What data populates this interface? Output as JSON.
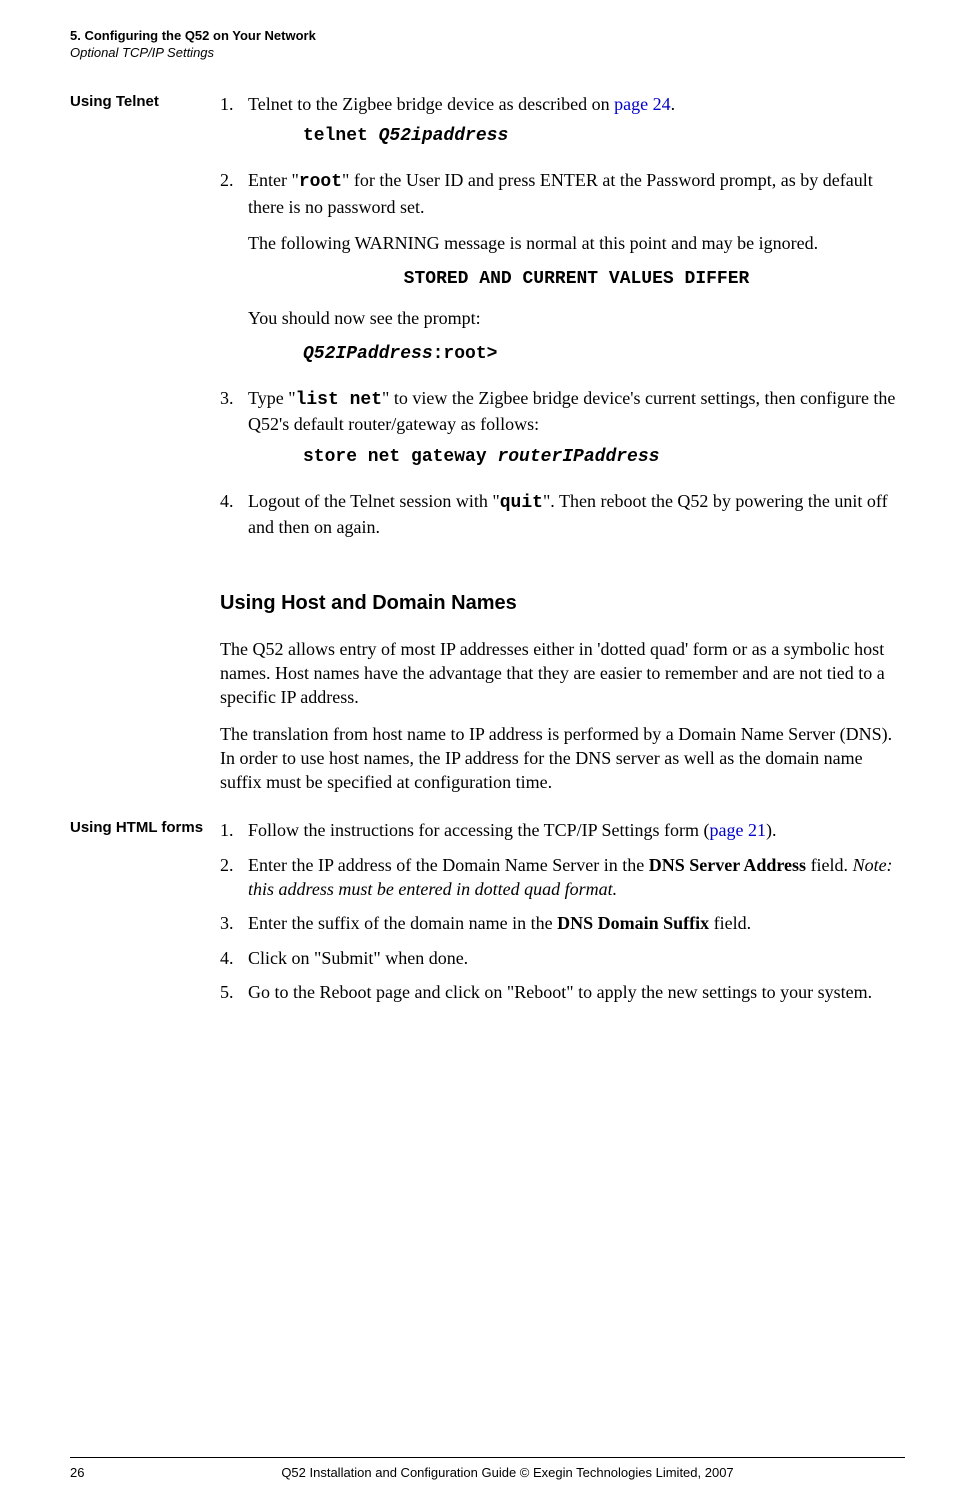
{
  "header": {
    "chapter": "5. Configuring the Q52 on Your Network",
    "section": "Optional TCP/IP Settings"
  },
  "telnet": {
    "sidehead": "Using Telnet",
    "step1_a": "Telnet to the Zigbee bridge device as described on ",
    "step1_link": "page 24",
    "step1_b": ".",
    "cmd1_a": "telnet ",
    "cmd1_arg": "Q52ipaddress",
    "step2_a": "Enter \"",
    "step2_code": "root",
    "step2_b": "\" for the User ID and press ENTER at the Password prompt, as by default there is no password set.",
    "warn_intro": "The following WARNING message is normal at this point and may be ignored.",
    "warn_msg": "STORED AND CURRENT VALUES DIFFER",
    "prompt_intro": "You should now see the prompt:",
    "prompt_arg": "Q52IPaddress",
    "prompt_tail": ":root>",
    "step3_a": "Type \"",
    "step3_code": "list net",
    "step3_b": "\" to view the Zigbee bridge device's current settings, then configure the Q52's default router/gateway as follows:",
    "cmd3_a": "store net gateway ",
    "cmd3_arg": "routerIPaddress",
    "step4_a": "Logout of the Telnet session with \"",
    "step4_code": "quit",
    "step4_b": "\". Then reboot the Q52 by powering the unit off and then on again."
  },
  "hostdomain": {
    "heading": "Using Host and Domain Names",
    "p1": "The Q52 allows entry of most IP addresses either in 'dotted quad' form or as a symbolic host names. Host names have the advantage that they are easier to remember and are not tied to a specific IP address.",
    "p2": "The translation from host name to IP address is performed by a Domain Name Server (DNS). In order to use host names, the IP address for the DNS server as well as the domain name suffix must be specified at configuration time."
  },
  "html": {
    "sidehead": "Using HTML forms",
    "s1_a": "Follow the instructions for accessing the TCP/IP Settings form (",
    "s1_link": "page 21",
    "s1_b": ").",
    "s2_a": "Enter the IP address of the Domain Name Server in the ",
    "s2_bold": "DNS Server Address",
    "s2_b": " field. ",
    "s2_note": "Note: this address must be entered in dotted quad format.",
    "s3_a": "Enter the suffix of the domain name in the ",
    "s3_bold": "DNS Domain Suffix",
    "s3_b": " field.",
    "s4": "Click on \"Submit\" when done.",
    "s5": "Go to the Reboot page and click on \"Reboot\" to apply the new settings to your system."
  },
  "footer": {
    "page": "26",
    "text": "Q52 Installation and Configuration Guide  © Exegin Technologies Limited, 2007"
  }
}
